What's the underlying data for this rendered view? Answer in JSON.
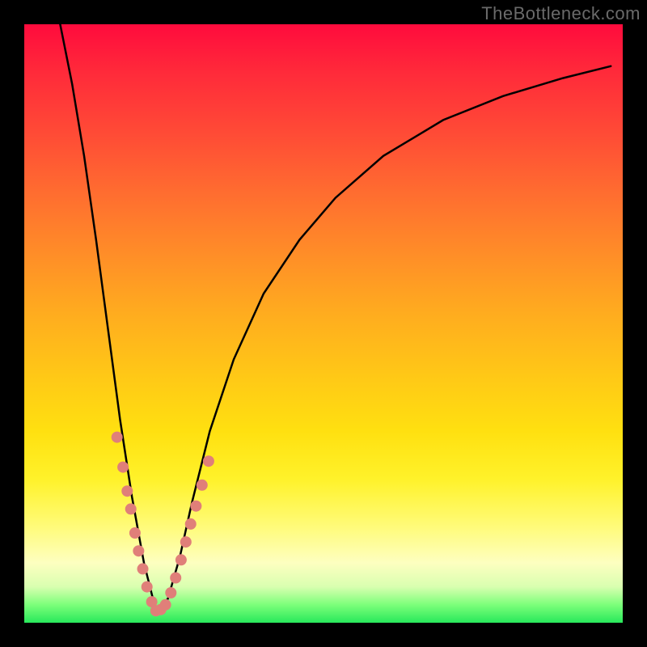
{
  "watermark": {
    "text": "TheBottleneck.com"
  },
  "chart_data": {
    "type": "line",
    "title": "",
    "xlabel": "",
    "ylabel": "",
    "xlim": [
      0,
      100
    ],
    "ylim": [
      0,
      100
    ],
    "background_gradient": {
      "top_color": "#ff0b3d",
      "bottom_color": "#28e85b",
      "meaning": "red = high bottleneck, green = low bottleneck"
    },
    "series": [
      {
        "name": "bottleneck-curve",
        "description": "V-shaped bottleneck percentage curve; minimum (optimal balance) near x≈22",
        "x": [
          6,
          8,
          10,
          12,
          14,
          16,
          18,
          20,
          22,
          24,
          26,
          28,
          31,
          35,
          40,
          46,
          52,
          60,
          70,
          80,
          90,
          98
        ],
        "y": [
          100,
          90,
          78,
          64,
          49,
          34,
          21,
          10,
          2,
          4,
          11,
          20,
          32,
          44,
          55,
          64,
          71,
          78,
          84,
          88,
          91,
          93
        ]
      }
    ],
    "markers": {
      "name": "sample-points",
      "color": "#e07f79",
      "xy": [
        [
          15.5,
          31
        ],
        [
          16.5,
          26
        ],
        [
          17.2,
          22
        ],
        [
          17.8,
          19
        ],
        [
          18.5,
          15
        ],
        [
          19.1,
          12
        ],
        [
          19.8,
          9
        ],
        [
          20.5,
          6
        ],
        [
          21.3,
          3.5
        ],
        [
          22.0,
          2
        ],
        [
          22.8,
          2.2
        ],
        [
          23.6,
          3
        ],
        [
          24.5,
          5
        ],
        [
          25.3,
          7.5
        ],
        [
          26.2,
          10.5
        ],
        [
          27.0,
          13.5
        ],
        [
          27.8,
          16.5
        ],
        [
          28.7,
          19.5
        ],
        [
          29.7,
          23
        ],
        [
          30.8,
          27
        ]
      ]
    }
  }
}
